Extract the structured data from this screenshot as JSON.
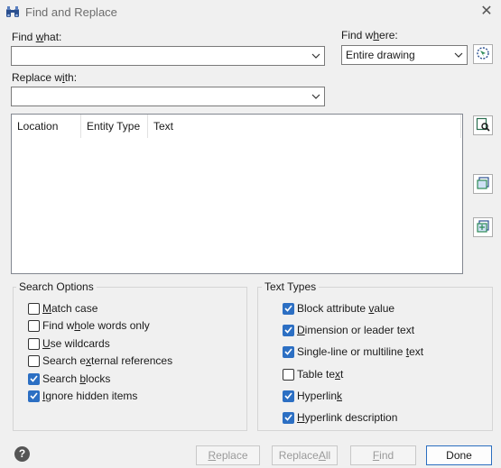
{
  "window": {
    "title": "Find and Replace",
    "close_glyph": "✕"
  },
  "find_what": {
    "label_pre": "Find ",
    "label_u": "w",
    "label_post": "hat:",
    "value": ""
  },
  "replace_with": {
    "label_pre": "Replace w",
    "label_u": "i",
    "label_post": "th:",
    "value": ""
  },
  "find_where": {
    "label_pre": "Find w",
    "label_u": "h",
    "label_post": "ere:",
    "value": "Entire drawing"
  },
  "results": {
    "columns": [
      "Location",
      "Entity Type",
      "Text"
    ]
  },
  "search_options": {
    "title": "Search Options",
    "items": [
      {
        "pre": "",
        "u": "M",
        "post": "atch case",
        "checked": false
      },
      {
        "pre": "Find w",
        "u": "h",
        "post": "ole words only",
        "checked": false
      },
      {
        "pre": "",
        "u": "U",
        "post": "se wildcards",
        "checked": false
      },
      {
        "pre": "Search e",
        "u": "x",
        "post": "ternal references",
        "checked": false
      },
      {
        "pre": "Search ",
        "u": "b",
        "post": "locks",
        "checked": true
      },
      {
        "pre": "",
        "u": "I",
        "post": "gnore hidden items",
        "checked": true
      }
    ]
  },
  "text_types": {
    "title": "Text Types",
    "items": [
      {
        "pre": "Block attribute ",
        "u": "v",
        "post": "alue",
        "checked": true
      },
      {
        "pre": "",
        "u": "D",
        "post": "imension or leader text",
        "checked": true
      },
      {
        "pre": "Single-line or multiline ",
        "u": "t",
        "post": "ext",
        "checked": true
      },
      {
        "pre": "Table te",
        "u": "x",
        "post": "t",
        "checked": false
      },
      {
        "pre": "Hyperlin",
        "u": "k",
        "post": "",
        "checked": true
      },
      {
        "pre": "",
        "u": "H",
        "post": "yperlink description",
        "checked": true
      }
    ]
  },
  "buttons": {
    "replace": {
      "pre": "",
      "u": "R",
      "post": "eplace"
    },
    "replace_all": {
      "pre": "Replace ",
      "u": "A",
      "post": "ll"
    },
    "find": {
      "pre": "",
      "u": "F",
      "post": "ind"
    },
    "done": "Done"
  },
  "help_glyph": "?",
  "colors": {
    "accent": "#2c6fc3",
    "background": "#f0f0f0"
  }
}
